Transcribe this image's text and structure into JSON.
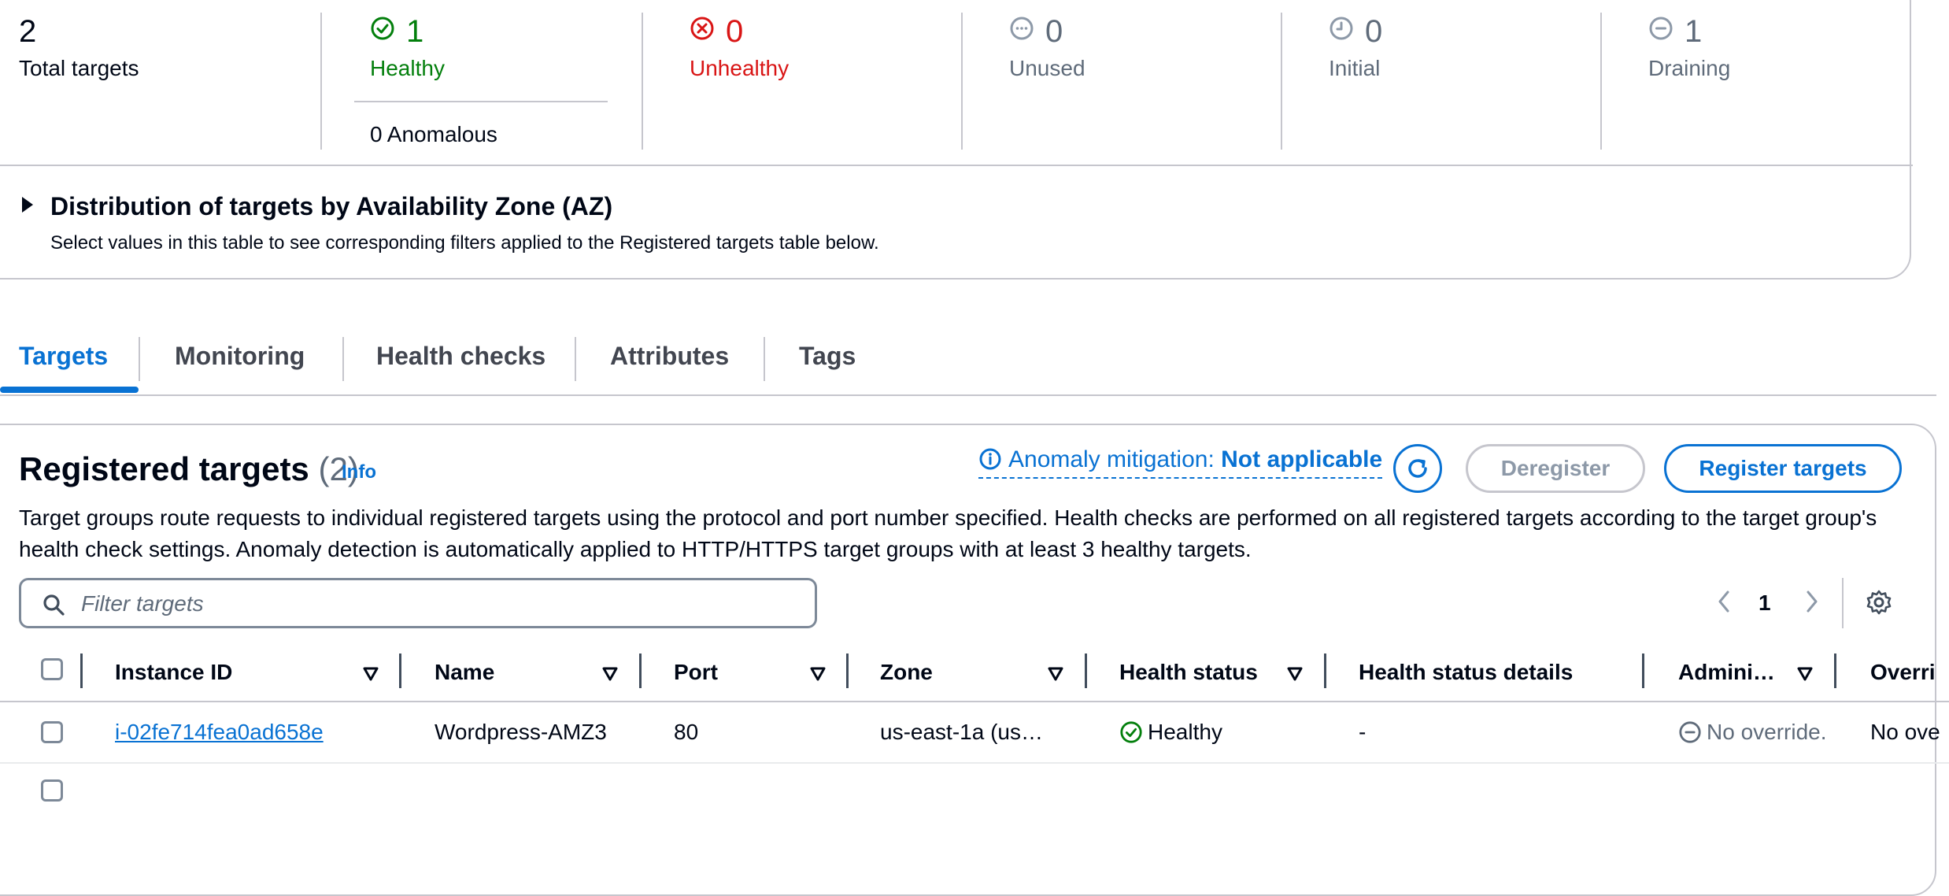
{
  "summary": {
    "total": {
      "count": "2",
      "label": "Total targets"
    },
    "healthy": {
      "count": "1",
      "label": "Healthy",
      "icon": "check-circle-icon"
    },
    "anomalous": {
      "label": "0 Anomalous"
    },
    "unhealthy": {
      "count": "0",
      "label": "Unhealthy",
      "icon": "x-circle-icon"
    },
    "unused": {
      "count": "0",
      "label": "Unused",
      "icon": "ellipsis-circle-icon"
    },
    "initial": {
      "count": "0",
      "label": "Initial",
      "icon": "clock-circle-icon"
    },
    "draining": {
      "count": "1",
      "label": "Draining",
      "icon": "minus-circle-icon"
    }
  },
  "az_distribution": {
    "title": "Distribution of targets by Availability Zone (AZ)",
    "subtitle": "Select values in this table to see corresponding filters applied to the Registered targets table below."
  },
  "tabs": [
    {
      "label": "Targets",
      "active": true
    },
    {
      "label": "Monitoring"
    },
    {
      "label": "Health checks"
    },
    {
      "label": "Attributes"
    },
    {
      "label": "Tags"
    }
  ],
  "registered_targets": {
    "title": "Registered targets",
    "count": "(2)",
    "info_label": "Info",
    "anomaly_prefix": "Anomaly mitigation:",
    "anomaly_value": "Not applicable",
    "deregister_label": "Deregister",
    "register_label": "Register targets",
    "description": "Target groups route requests to individual registered targets using the protocol and port number specified. Health checks are performed on all registered targets according to the target group's health check settings. Anomaly detection is automatically applied to HTTP/HTTPS target groups with at least 3 healthy targets.",
    "filter_placeholder": "Filter targets",
    "filter_value": "",
    "page": "1"
  },
  "table": {
    "columns": [
      "Instance ID",
      "Name",
      "Port",
      "Zone",
      "Health status",
      "Health status details",
      "Admini…",
      "Overri"
    ],
    "rows": [
      {
        "instance_id": "i-02fe714fea0ad658e",
        "name": "Wordpress-AMZ3",
        "port": "80",
        "zone": "us-east-1a (us…",
        "health_status": "Healthy",
        "health_details": "-",
        "admin_override": "No override.",
        "override": "No ove"
      }
    ]
  },
  "colors": {
    "accent": "#0972d3",
    "healthy": "#037f0c",
    "unhealthy": "#d91515",
    "muted": "#5f6b7a",
    "border": "#c6c6cd"
  }
}
